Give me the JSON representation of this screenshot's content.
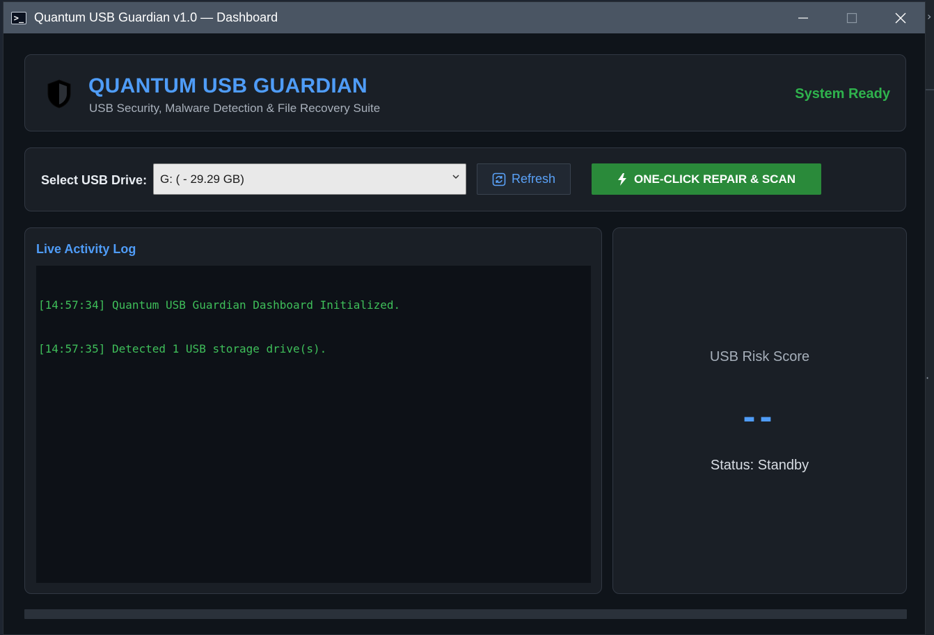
{
  "window": {
    "title": "Quantum USB Guardian v1.0 — Dashboard",
    "controls": [
      "minimize",
      "maximize",
      "close"
    ]
  },
  "header": {
    "icon": "shield-icon",
    "title": "QUANTUM USB GUARDIAN",
    "subtitle": "USB Security, Malware Detection & File Recovery Suite",
    "status": "System Ready"
  },
  "drive_selector": {
    "label": "Select USB Drive:",
    "selected": "G: ( - 29.29 GB)",
    "refresh_label": "Refresh",
    "scan_label": "ONE-CLICK REPAIR & SCAN"
  },
  "log": {
    "title": "Live Activity Log",
    "lines": [
      "[14:57:34] Quantum USB Guardian Dashboard Initialized.",
      "[14:57:35] Detected 1 USB storage drive(s)."
    ]
  },
  "risk": {
    "label": "USB Risk Score",
    "score": "--",
    "status": "Status: Standby"
  },
  "progress": {
    "value": 0
  },
  "colors": {
    "accent": "#4f9cf7",
    "success": "#2fb34d",
    "scan_button": "#2a8a3a",
    "log_text": "#3fbf5a",
    "background": "#0f141a",
    "panel": "#1a1f26"
  }
}
